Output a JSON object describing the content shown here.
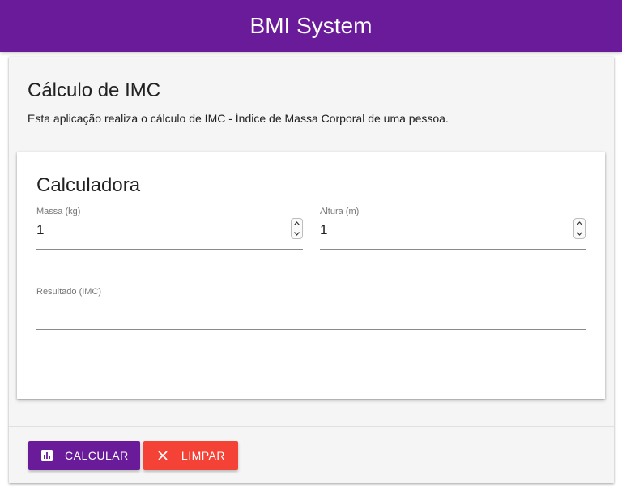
{
  "header": {
    "title": "BMI System"
  },
  "page": {
    "title": "Cálculo de IMC",
    "description": "Esta aplicação realiza o cálculo de IMC - Índice de Massa Corporal de uma pessoa."
  },
  "calculator": {
    "title": "Calculadora",
    "massa": {
      "label": "Massa (kg)",
      "value": "1"
    },
    "altura": {
      "label": "Altura (m)",
      "value": "1"
    },
    "resultado": {
      "label": "Resultado (IMC)",
      "value": ""
    }
  },
  "actions": {
    "calcular": {
      "label": "CALCULAR",
      "icon": "bar-chart-icon"
    },
    "limpar": {
      "label": "LIMPAR",
      "icon": "close-icon"
    }
  },
  "colors": {
    "primary": "#6a1b9a",
    "danger": "#f44336"
  }
}
